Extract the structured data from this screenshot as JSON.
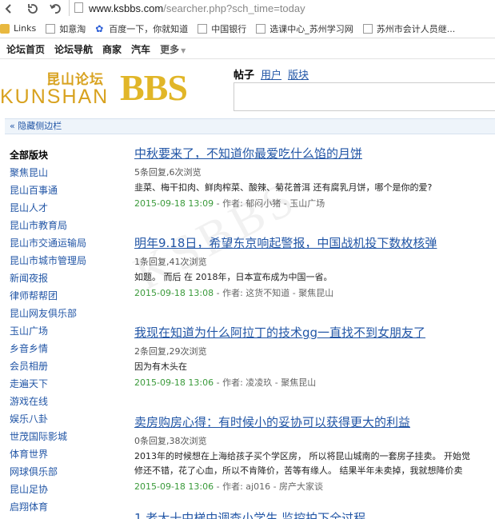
{
  "browser": {
    "url_host": "www.ksbbs.com",
    "url_path": "/searcher.php?sch_time=today"
  },
  "bookmarks": [
    {
      "label": "Links",
      "icon": "folder-icon"
    },
    {
      "label": "如意淘",
      "icon": "page-icon"
    },
    {
      "label": "百度一下，你就知道",
      "icon": "paw-icon"
    },
    {
      "label": "中国银行",
      "icon": "page-icon"
    },
    {
      "label": "选课中心_苏州学习网",
      "icon": "page-icon"
    },
    {
      "label": "苏州市会计人员继...",
      "icon": "page-icon"
    }
  ],
  "sitenav": {
    "items": [
      "论坛首页",
      "论坛导航",
      "商家",
      "汽车"
    ],
    "more": "更多"
  },
  "logo": {
    "cn": "昆山论坛",
    "en": "KUNSHAN",
    "bbs": "BBS"
  },
  "search": {
    "tabs": {
      "posts": "帖子",
      "users": "用户",
      "sections": "版块"
    }
  },
  "toggle": {
    "label": "« 隐藏侧边栏"
  },
  "sidebar": {
    "heading": "全部版块",
    "items": [
      "聚焦昆山",
      "昆山百事通",
      "昆山人才",
      "昆山市教育局",
      "昆山市交通运输局",
      "昆山市城市管理局",
      "新闻夜报",
      "律师帮帮团",
      "昆山网友俱乐部",
      "玉山广场",
      "乡音乡情",
      "会员相册",
      "走遍天下",
      "游戏在线",
      "娱乐八卦",
      "世茂国际影城",
      "体育世界",
      "网球俱乐部",
      "昆山足协",
      "启翔体育"
    ]
  },
  "threads": [
    {
      "title": "中秋要来了，不知道你最爱吃什么馅的月饼",
      "stats": "5条回复,6次浏览",
      "excerpt": "韭菜、梅干扣肉、鲜肉榨菜、酸辣、菊花普洱 还有腐乳月饼，哪个是你的爱?",
      "date": "2015-09-18 13:09",
      "meta": " - 作者: 郁闷小猪 - 玉山广场"
    },
    {
      "title": "明年9.18日，希望东京响起警报，中国战机投下数枚核弹",
      "stats": "1条回复,41次浏览",
      "excerpt": "如题。 而后 在 2018年，日本宣布成为中国一省。",
      "date": "2015-09-18 13:08",
      "meta": " - 作者: 这货不知道 - 聚焦昆山"
    },
    {
      "title": "我现在知道为什么阿拉丁的技术gg一直找不到女朋友了",
      "stats": "2条回复,29次浏览",
      "excerpt": "因为有木头在",
      "date": "2015-09-18 13:06",
      "meta": " - 作者: 凌凌玖 - 聚焦昆山"
    },
    {
      "title": "卖房购房心得：有时候小的妥协可以获得更大的利益",
      "stats": "0条回复,38次浏览",
      "excerpt": "2013年的时候想在上海给孩子买个学区房， 所以将昆山城南的一套房子挂卖。 开始觉\n修还不错，花了心血，所以不肯降价，苦等有缘人。 结果半年未卖掉，我就想降价卖",
      "date": "2015-09-18 13:06",
      "meta": " - 作者: aj016 - 房产大家谈"
    }
  ],
  "partial_title": "1 老大十中梯中调查小学生 监控拍下全过程"
}
